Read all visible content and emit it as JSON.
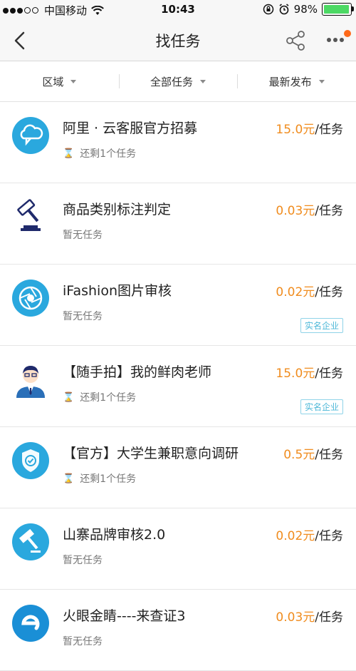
{
  "status": {
    "carrier": "中国移动",
    "time": "10:43",
    "battery_text": "98%",
    "battery_level": 0.98
  },
  "nav": {
    "title": "找任务"
  },
  "filters": [
    {
      "label": "区域"
    },
    {
      "label": "全部任务"
    },
    {
      "label": "最新发布"
    }
  ],
  "tasks": [
    {
      "name": "阿里 · 云客服官方招募",
      "status": "还剩1个任务",
      "price": "15.0元",
      "unit": "/任务",
      "badge": "",
      "icon": "cloud-chat-icon"
    },
    {
      "name": "商品类别标注判定",
      "status": "暂无任务",
      "price": "0.03元",
      "unit": "/任务",
      "badge": "",
      "icon": "gavel-icon"
    },
    {
      "name": "iFashion图片审核",
      "status": "暂无任务",
      "price": "0.02元",
      "unit": "/任务",
      "badge": "实名企业",
      "icon": "camera-aperture-icon"
    },
    {
      "name": "【随手拍】我的鲜肉老师",
      "status": "还剩1个任务",
      "price": "15.0元",
      "unit": "/任务",
      "badge": "实名企业",
      "icon": "teacher-avatar-icon"
    },
    {
      "name": "【官方】大学生兼职意向调研",
      "status": "还剩1个任务",
      "price": "0.5元",
      "unit": "/任务",
      "badge": "",
      "icon": "shield-check-icon"
    },
    {
      "name": "山寨品牌审核2.0",
      "status": "暂无任务",
      "price": "0.02元",
      "unit": "/任务",
      "badge": "",
      "icon": "hammer-icon"
    },
    {
      "name": "火眼金睛----来查证3",
      "status": "暂无任务",
      "price": "0.03元",
      "unit": "/任务",
      "badge": "",
      "icon": "letter-e-icon"
    }
  ],
  "colors": {
    "accent_blue": "#2aa8de",
    "price_orange": "#f08c1e",
    "dark_navy": "#1f2a6b"
  }
}
